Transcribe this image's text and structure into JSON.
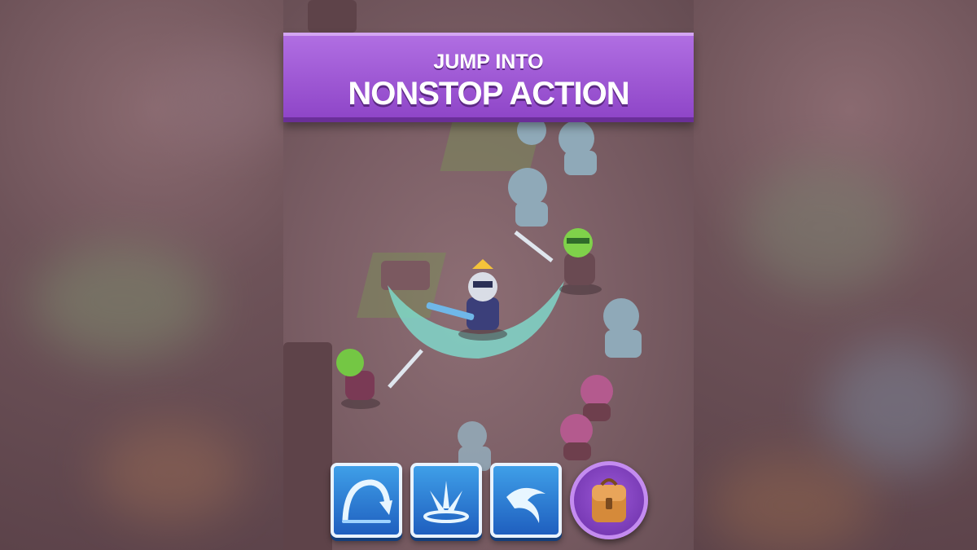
{
  "banner": {
    "line1": "JUMP INTO",
    "line2": "NONSTOP ACTION"
  },
  "abilities": [
    {
      "name": "leap-slam-ability",
      "icon": "arc-down-icon"
    },
    {
      "name": "ground-burst-ability",
      "icon": "burst-icon"
    },
    {
      "name": "dash-ability",
      "icon": "swoosh-icon"
    }
  ],
  "inventory": {
    "icon": "backpack-icon"
  },
  "colors": {
    "banner": "#9b55d4",
    "ability": "#2f80d8",
    "bag": "#8a45c8",
    "slash": "#7fe6d6"
  }
}
